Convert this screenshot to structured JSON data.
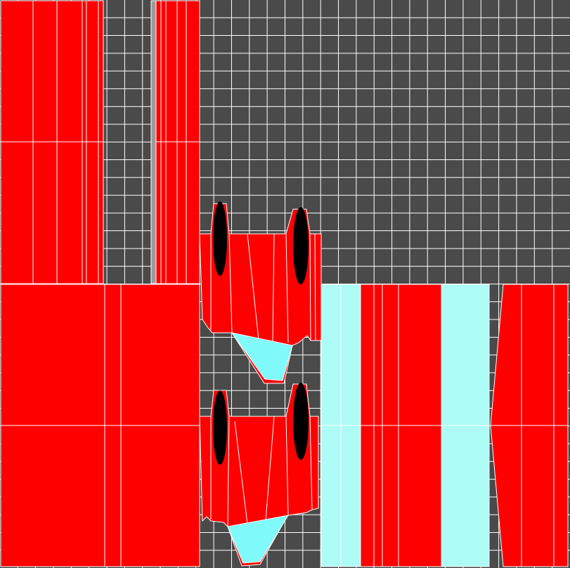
{
  "palette": {
    "background": "#4a4a4a",
    "grid_line": "#5a5a5a",
    "island_fill": "#ff0000",
    "island_fill_alt": "#ff0000",
    "island_fill_cyan": "#aefcf6",
    "island_fill_bright_cyan": "#80fafa",
    "island_stroke": "#ffffff",
    "hole_fill": "#000000",
    "gray_strip": "#9a9a9a"
  },
  "grid": {
    "cells": 32
  },
  "islands": {
    "count": 10
  }
}
